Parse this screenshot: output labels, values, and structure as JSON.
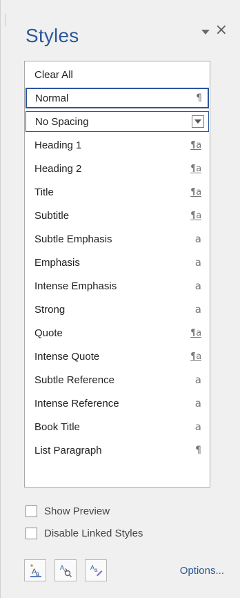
{
  "pane": {
    "title": "Styles",
    "controls": {
      "dropdown_icon": "dropdown-arrow-icon",
      "close_icon": "close-icon"
    }
  },
  "styles": {
    "items": [
      {
        "label": "Clear All",
        "mark": "",
        "mark_type": "none"
      },
      {
        "label": "Normal",
        "mark": "¶",
        "mark_type": "para"
      },
      {
        "label": "No Spacing",
        "mark": "",
        "mark_type": "dropdown"
      },
      {
        "label": "Heading 1",
        "mark": "¶a",
        "mark_type": "link"
      },
      {
        "label": "Heading 2",
        "mark": "¶a",
        "mark_type": "link"
      },
      {
        "label": "Title",
        "mark": "¶a",
        "mark_type": "link"
      },
      {
        "label": "Subtitle",
        "mark": "¶a",
        "mark_type": "link"
      },
      {
        "label": "Subtle Emphasis",
        "mark": "a",
        "mark_type": "char"
      },
      {
        "label": "Emphasis",
        "mark": "a",
        "mark_type": "char"
      },
      {
        "label": "Intense Emphasis",
        "mark": "a",
        "mark_type": "char"
      },
      {
        "label": "Strong",
        "mark": "a",
        "mark_type": "char"
      },
      {
        "label": "Quote",
        "mark": "¶a",
        "mark_type": "link"
      },
      {
        "label": "Intense Quote",
        "mark": "¶a",
        "mark_type": "link"
      },
      {
        "label": "Subtle Reference",
        "mark": "a",
        "mark_type": "char"
      },
      {
        "label": "Intense Reference",
        "mark": "a",
        "mark_type": "char"
      },
      {
        "label": "Book Title",
        "mark": "a",
        "mark_type": "char"
      },
      {
        "label": "List Paragraph",
        "mark": "¶",
        "mark_type": "para"
      }
    ]
  },
  "options": {
    "show_preview": "Show Preview",
    "disable_linked_styles": "Disable Linked Styles"
  },
  "bottom": {
    "buttons": [
      {
        "icon": "new-style-icon"
      },
      {
        "icon": "style-inspector-icon"
      },
      {
        "icon": "manage-styles-icon"
      }
    ],
    "options_label": "Options..."
  },
  "colors": {
    "accent": "#2b579a",
    "pane_bg": "#f0f0f0",
    "list_bg": "#ffffff",
    "mark": "#767676"
  }
}
